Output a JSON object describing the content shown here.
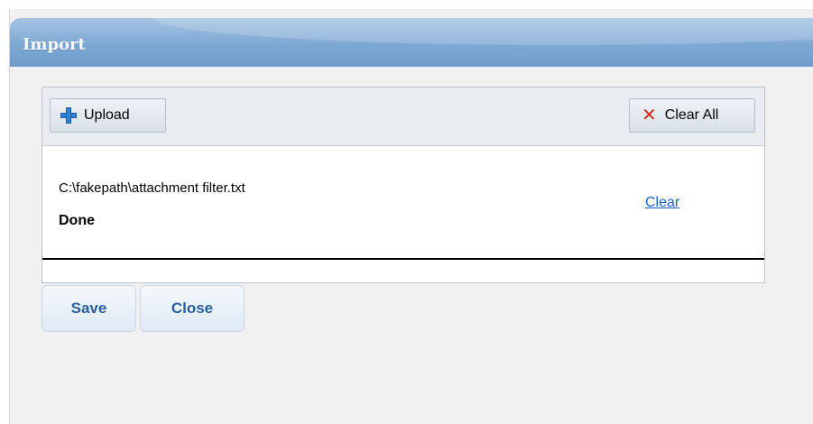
{
  "dialog": {
    "title": "Import"
  },
  "toolbar": {
    "upload_label": "Upload",
    "upload_icon": "plus-icon",
    "clear_all_label": "Clear All",
    "clear_all_icon": "close-icon"
  },
  "files": [
    {
      "path": "C:\\fakepath\\attachment filter.txt",
      "status": "Done",
      "action_label": "Clear"
    }
  ],
  "actions": {
    "save_label": "Save",
    "close_label": "Close"
  },
  "colors": {
    "title_bar": "#7ea8d4",
    "link": "#1a5fd0",
    "clear_all_icon": "#d32a1e",
    "upload_icon": "#2f83d6",
    "action_text": "#2a5f9a"
  }
}
